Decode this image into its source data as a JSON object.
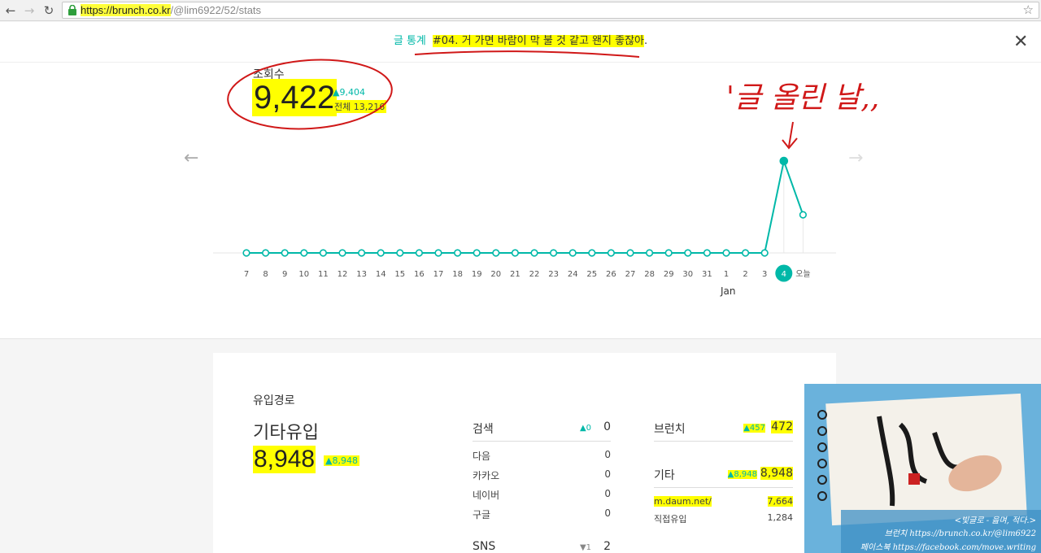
{
  "browser": {
    "url_host": "https://brunch.co.kr",
    "url_path": "/@lim6922/52/stats",
    "back_icon": "arrow-left-icon",
    "forward_icon": "arrow-right-icon",
    "reload_icon": "reload-icon",
    "lock_icon": "lock-icon",
    "bookmark_icon": "star-icon"
  },
  "header": {
    "label": "글 통계",
    "post_title": "#04. 거 가면 바람이 막 불 것 같고 왠지 좋잖아",
    "post_title_end": "."
  },
  "views": {
    "label": "조회수",
    "count": "9,422",
    "delta": "▲9,404",
    "total": "전체 13,216"
  },
  "chart_data": {
    "type": "line",
    "x": [
      "7",
      "8",
      "9",
      "10",
      "11",
      "12",
      "13",
      "14",
      "15",
      "16",
      "17",
      "18",
      "19",
      "20",
      "21",
      "22",
      "23",
      "24",
      "25",
      "26",
      "27",
      "28",
      "29",
      "30",
      "31",
      "1",
      "2",
      "3",
      "4",
      "오늘"
    ],
    "values": [
      0,
      0,
      0,
      0,
      0,
      0,
      0,
      0,
      0,
      0,
      0,
      0,
      0,
      0,
      0,
      0,
      0,
      0,
      0,
      0,
      0,
      0,
      0,
      0,
      0,
      0,
      0,
      0,
      9404,
      3900
    ],
    "selected_index": 28,
    "month_label": "Jan",
    "line_color": "#00b8a8"
  },
  "annotation": {
    "text": "'글 올린 날,,"
  },
  "inflow": {
    "label": "유입경로",
    "top_name": "기타유입",
    "top_count": "8,948",
    "top_delta": "▲8,948",
    "search": {
      "title": "검색",
      "delta": "▲0",
      "total": "0",
      "rows": [
        {
          "name": "다음",
          "value": "0"
        },
        {
          "name": "카카오",
          "value": "0"
        },
        {
          "name": "네이버",
          "value": "0"
        },
        {
          "name": "구글",
          "value": "0"
        }
      ]
    },
    "sns": {
      "title": "SNS",
      "delta": "▼1",
      "total": "2"
    },
    "brunch": {
      "title": "브런치",
      "delta": "▲457",
      "total": "472"
    },
    "etc": {
      "title": "기타",
      "delta": "▲8,948",
      "total": "8,948",
      "rows": [
        {
          "name": "m.daum.net/",
          "value": "7,664"
        },
        {
          "name": "직접유입",
          "value": "1,284"
        }
      ]
    }
  },
  "photo": {
    "line1": "<빛글로 - 읊며, 적다.>",
    "line2": "브런치 https://brunch.co.kr/@lim6922",
    "line3": "페이스북 https://facebook.com/move.writing"
  },
  "close_icon": "close-icon"
}
